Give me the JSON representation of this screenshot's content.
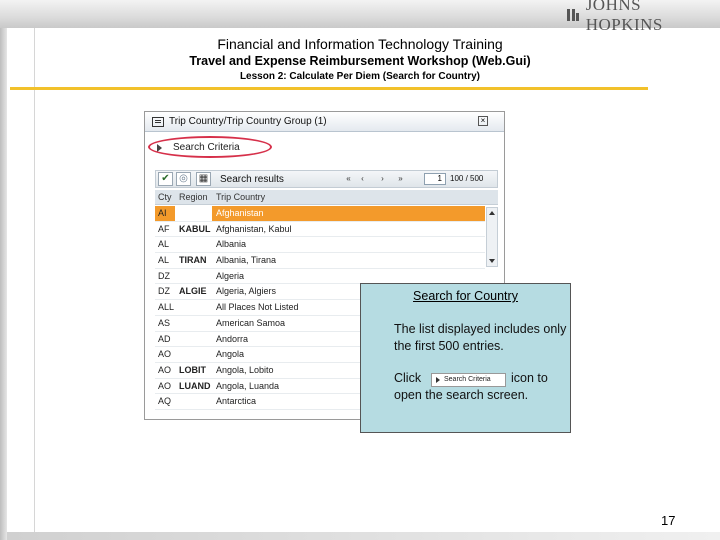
{
  "header": {
    "logo_text": "JOHNS HOPKINS",
    "title": "Financial and Information Technology Training",
    "subtitle": "Travel and Expense Reimbursement Workshop (Web.Gui)",
    "lesson": "Lesson 2: Calculate Per Diem (Search for Country)"
  },
  "panel": {
    "title": "Trip Country/Trip Country Group (1)",
    "close_symbol": "×",
    "search_criteria_label": "Search Criteria",
    "toolbar": {
      "results_title": "Search results",
      "page_value": "1",
      "range_text": "100 / 500",
      "nav_first": "«",
      "nav_prev": "‹",
      "nav_next": "›",
      "nav_last": "»",
      "check_symbol": "✔"
    },
    "columns": [
      "Cty",
      "Region",
      "Trip Country"
    ],
    "rows": [
      {
        "cty": "AI",
        "region": "",
        "country": "Afghanistan",
        "selected": true
      },
      {
        "cty": "AF",
        "region": "KABUL",
        "country": "Afghanistan, Kabul",
        "selected": false
      },
      {
        "cty": "AL",
        "region": "",
        "country": "Albania",
        "selected": false
      },
      {
        "cty": "AL",
        "region": "TIRAN",
        "country": "Albania, Tirana",
        "selected": false
      },
      {
        "cty": "DZ",
        "region": "",
        "country": "Algeria",
        "selected": false
      },
      {
        "cty": "DZ",
        "region": "ALGIE",
        "country": "Algeria, Algiers",
        "selected": false
      },
      {
        "cty": "ALL",
        "region": "",
        "country": "All Places Not Listed",
        "selected": false
      },
      {
        "cty": "AS",
        "region": "",
        "country": "American Samoa",
        "selected": false
      },
      {
        "cty": "AD",
        "region": "",
        "country": "Andorra",
        "selected": false
      },
      {
        "cty": "AO",
        "region": "",
        "country": "Angola",
        "selected": false
      },
      {
        "cty": "AO",
        "region": "LOBIT",
        "country": "Angola, Lobito",
        "selected": false
      },
      {
        "cty": "AO",
        "region": "LUAND",
        "country": "Angola, Luanda",
        "selected": false
      },
      {
        "cty": "AQ",
        "region": "",
        "country": "Antarctica",
        "selected": false
      }
    ]
  },
  "callout": {
    "title": "Search for Country",
    "paragraph": "The list displayed includes only the first 500 entries.",
    "click_word": "Click",
    "chip_label": "Search Criteria",
    "icon_to": "icon to",
    "line2": "open the search screen."
  },
  "page_number": "17",
  "colors": {
    "accent_rule": "#f2c12a",
    "selected_row": "#f39a2b",
    "callout_bg": "#b6dce2",
    "oval": "#d6304a"
  }
}
